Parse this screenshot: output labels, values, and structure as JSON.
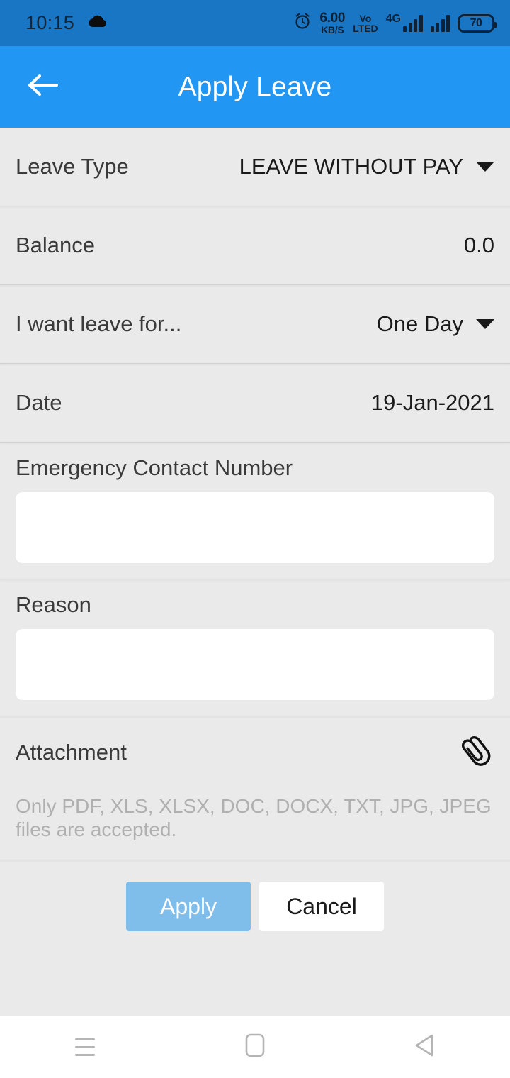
{
  "status_bar": {
    "time": "10:15",
    "cloud_icon": "cloud-icon",
    "alarm_icon": "alarm-icon",
    "net_speed_value": "6.00",
    "net_speed_unit": "KB/S",
    "volte_top": "Vo",
    "volte_bottom": "LTED",
    "network_type": "4G",
    "battery_percent": "70",
    "background_color": "#1976c5"
  },
  "app_bar": {
    "back_icon": "arrow-left-icon",
    "title": "Apply Leave",
    "background_color": "#2196f3"
  },
  "form": {
    "leave_type": {
      "label": "Leave Type",
      "value": "LEAVE WITHOUT PAY"
    },
    "balance": {
      "label": "Balance",
      "value": "0.0"
    },
    "duration": {
      "label": "I want leave for...",
      "value": "One Day"
    },
    "date": {
      "label": "Date",
      "value": "19-Jan-2021"
    },
    "emergency_contact": {
      "label": "Emergency Contact Number",
      "value": "",
      "placeholder": ""
    },
    "reason": {
      "label": "Reason",
      "value": "",
      "placeholder": ""
    },
    "attachment": {
      "label": "Attachment",
      "icon": "paperclip-icon",
      "hint": "Only PDF, XLS, XLSX, DOC, DOCX, TXT, JPG, JPEG files are accepted."
    }
  },
  "actions": {
    "apply_label": "Apply",
    "apply_color": "#7fbdeb",
    "cancel_label": "Cancel",
    "cancel_color": "#ffffff"
  },
  "nav_bar": {
    "recents_icon": "menu-icon",
    "home_icon": "home-square-icon",
    "back_icon": "back-triangle-icon"
  }
}
